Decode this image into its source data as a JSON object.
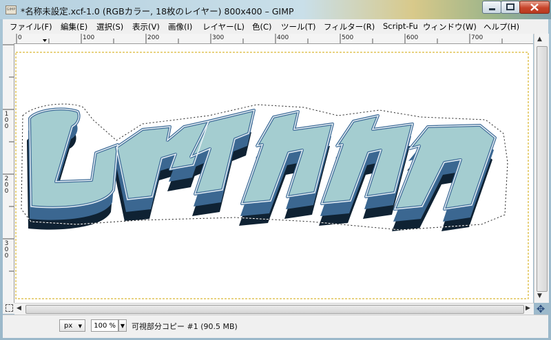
{
  "window": {
    "app_icon_label": "GIMP",
    "title": "*名称未設定.xcf-1.0 (RGBカラー, 18枚のレイヤー) 800x400 – GIMP",
    "controls": [
      "minimize",
      "maximize",
      "close"
    ]
  },
  "menu": [
    "ファイル(F)",
    "編集(E)",
    "選択(S)",
    "表示(V)",
    "画像(I)",
    "レイヤー(L)",
    "色(C)",
    "ツール(T)",
    "フィルター(R)",
    "Script-Fu",
    "ウィンドウ(W)",
    "ヘルプ(H)"
  ],
  "ruler": {
    "horizontal_labels": [
      "0",
      "100",
      "200",
      "300",
      "400",
      "500",
      "600",
      "700"
    ],
    "vertical_labels": [
      "100",
      "200",
      "300"
    ]
  },
  "canvas": {
    "artwork_text": "レイイカカ",
    "colors": {
      "face": "#a4cdd0",
      "face_outline": "#3f6c98",
      "extrusion": "#3b6791",
      "shadow": "#0f2233",
      "outer_stroke": "#e8f1f6"
    }
  },
  "statusbar": {
    "unit": "px",
    "zoom": "100 %",
    "status": "可視部分コピー #1 (90.5 MB)"
  },
  "icons": {
    "nav": "navigate-icon",
    "quickmask": "quickmask-icon"
  }
}
